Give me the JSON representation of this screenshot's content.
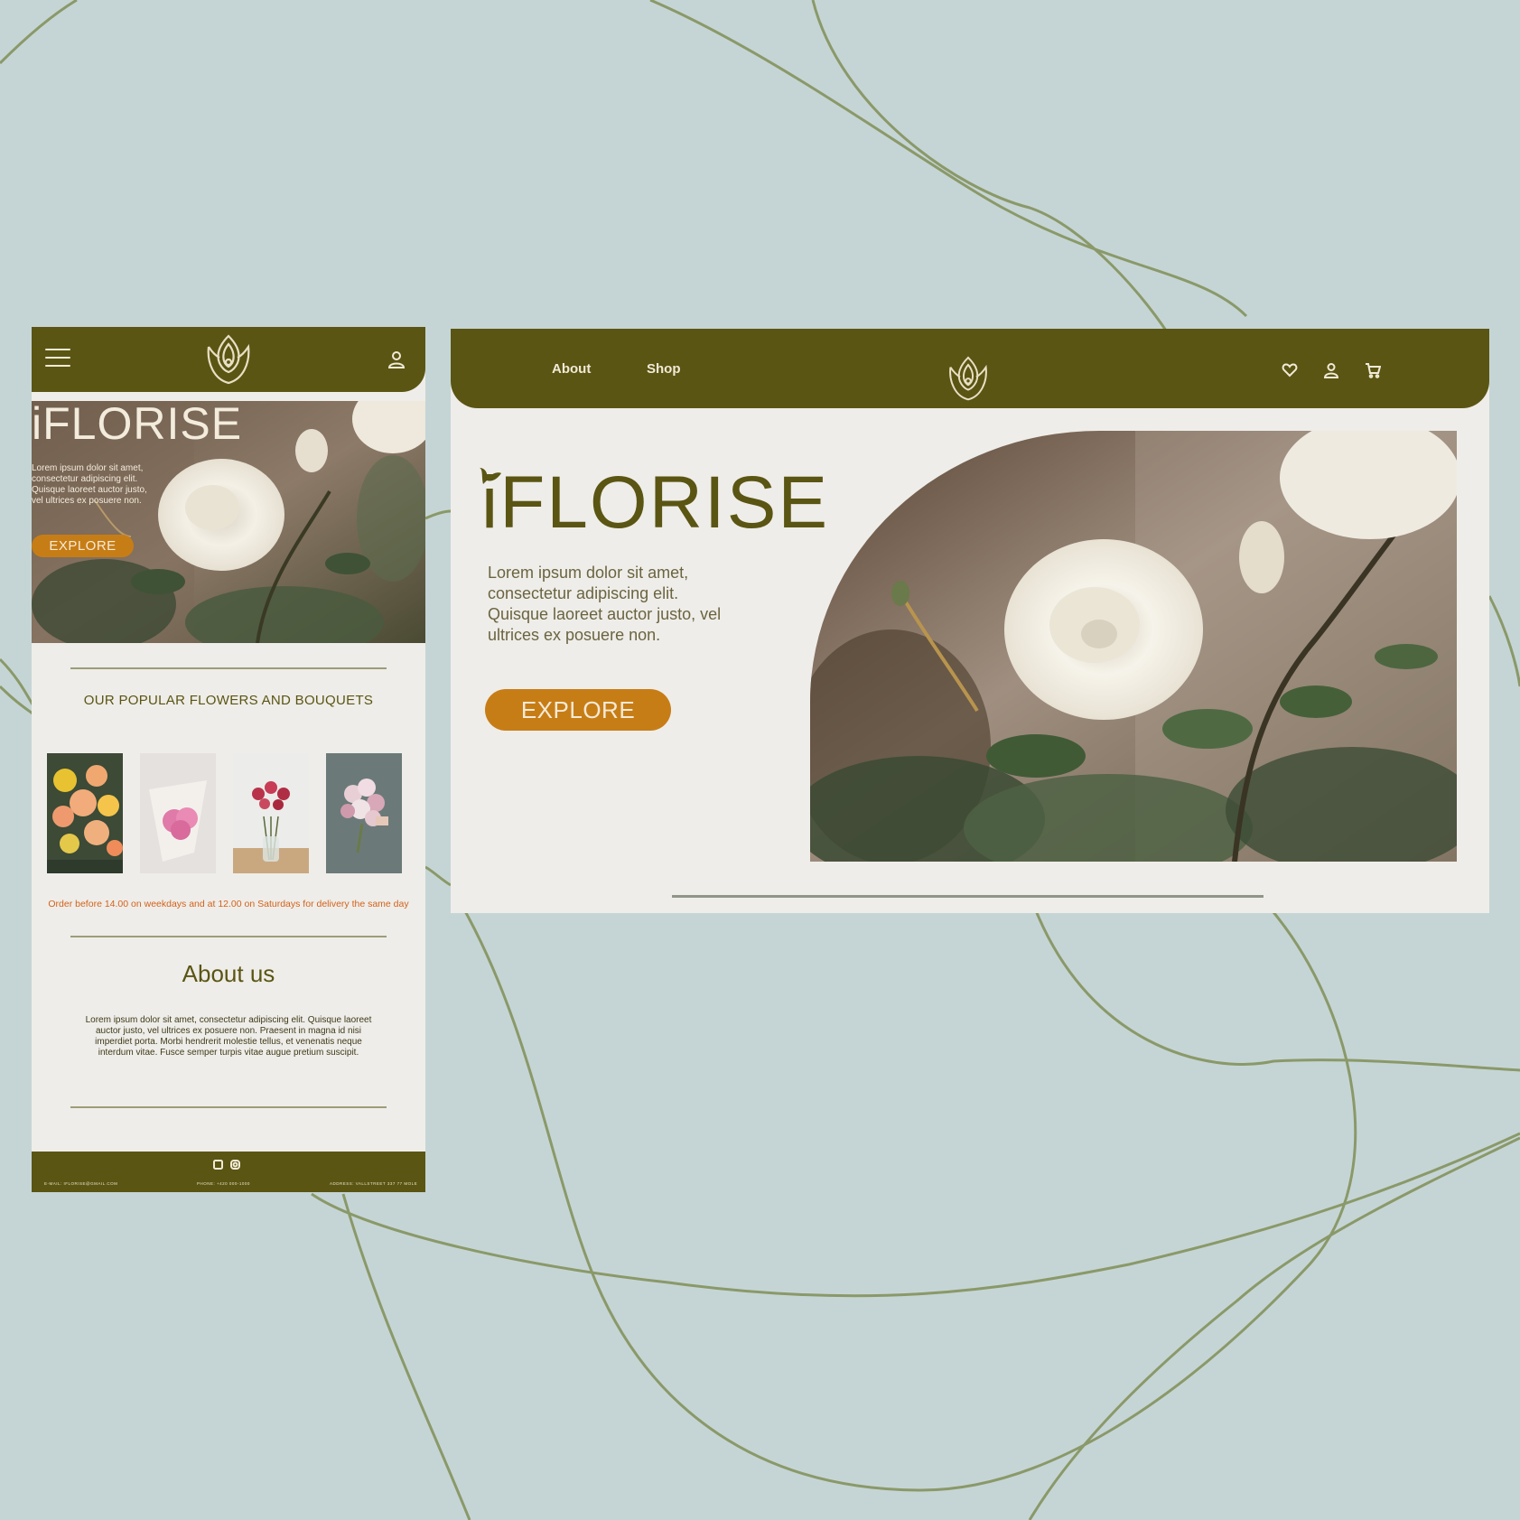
{
  "colors": {
    "background": "#c5d5d6",
    "brand_olive": "#5a5513",
    "accent_orange": "#c77d16",
    "notice_orange": "#d2621a",
    "page_bg": "#efede9"
  },
  "mobile": {
    "header": {
      "menu_icon": "hamburger-icon",
      "logo_icon": "lotus-logo-icon",
      "account_icon": "user-icon"
    },
    "hero": {
      "brand": "iFLORISE",
      "text": "Lorem ipsum dolor sit amet, consectetur adipiscing elit. Quisque laoreet auctor justo, vel ultrices ex posuere non.",
      "button": "EXPLORE"
    },
    "popular": {
      "heading": "OUR POPULAR FLOWERS AND BOUQUETS",
      "order_notice": "Order before 14.00 on weekdays and at 12.00 on Saturdays for delivery the same day"
    },
    "about": {
      "heading": "About us",
      "text": "Lorem ipsum dolor sit amet, consectetur adipiscing elit. Quisque laoreet auctor justo, vel ultrices ex posuere non. Praesent in magna id nisi imperdiet porta. Morbi hendrerit molestie tellus, et venenatis neque interdum vitae. Fusce semper turpis vitae augue pretium suscipit."
    },
    "footer": {
      "social_icons": [
        "facebook-icon",
        "instagram-icon"
      ],
      "email": "E-MAIL: IFLORISE@GMAIL.COM",
      "phone": "PHONE: +420 000-1000",
      "address": "ADDRESS: VALLSTREET 337 77 MOLE"
    }
  },
  "desktop": {
    "nav": {
      "about": "About",
      "shop": "Shop"
    },
    "header_icons": [
      "heart-icon",
      "user-icon",
      "cart-icon"
    ],
    "hero": {
      "brand": "iFLORISE",
      "text": "Lorem ipsum dolor sit amet, consectetur adipiscing elit. Quisque laoreet auctor justo, vel ultrices ex posuere non.",
      "button": "EXPLORE"
    }
  }
}
